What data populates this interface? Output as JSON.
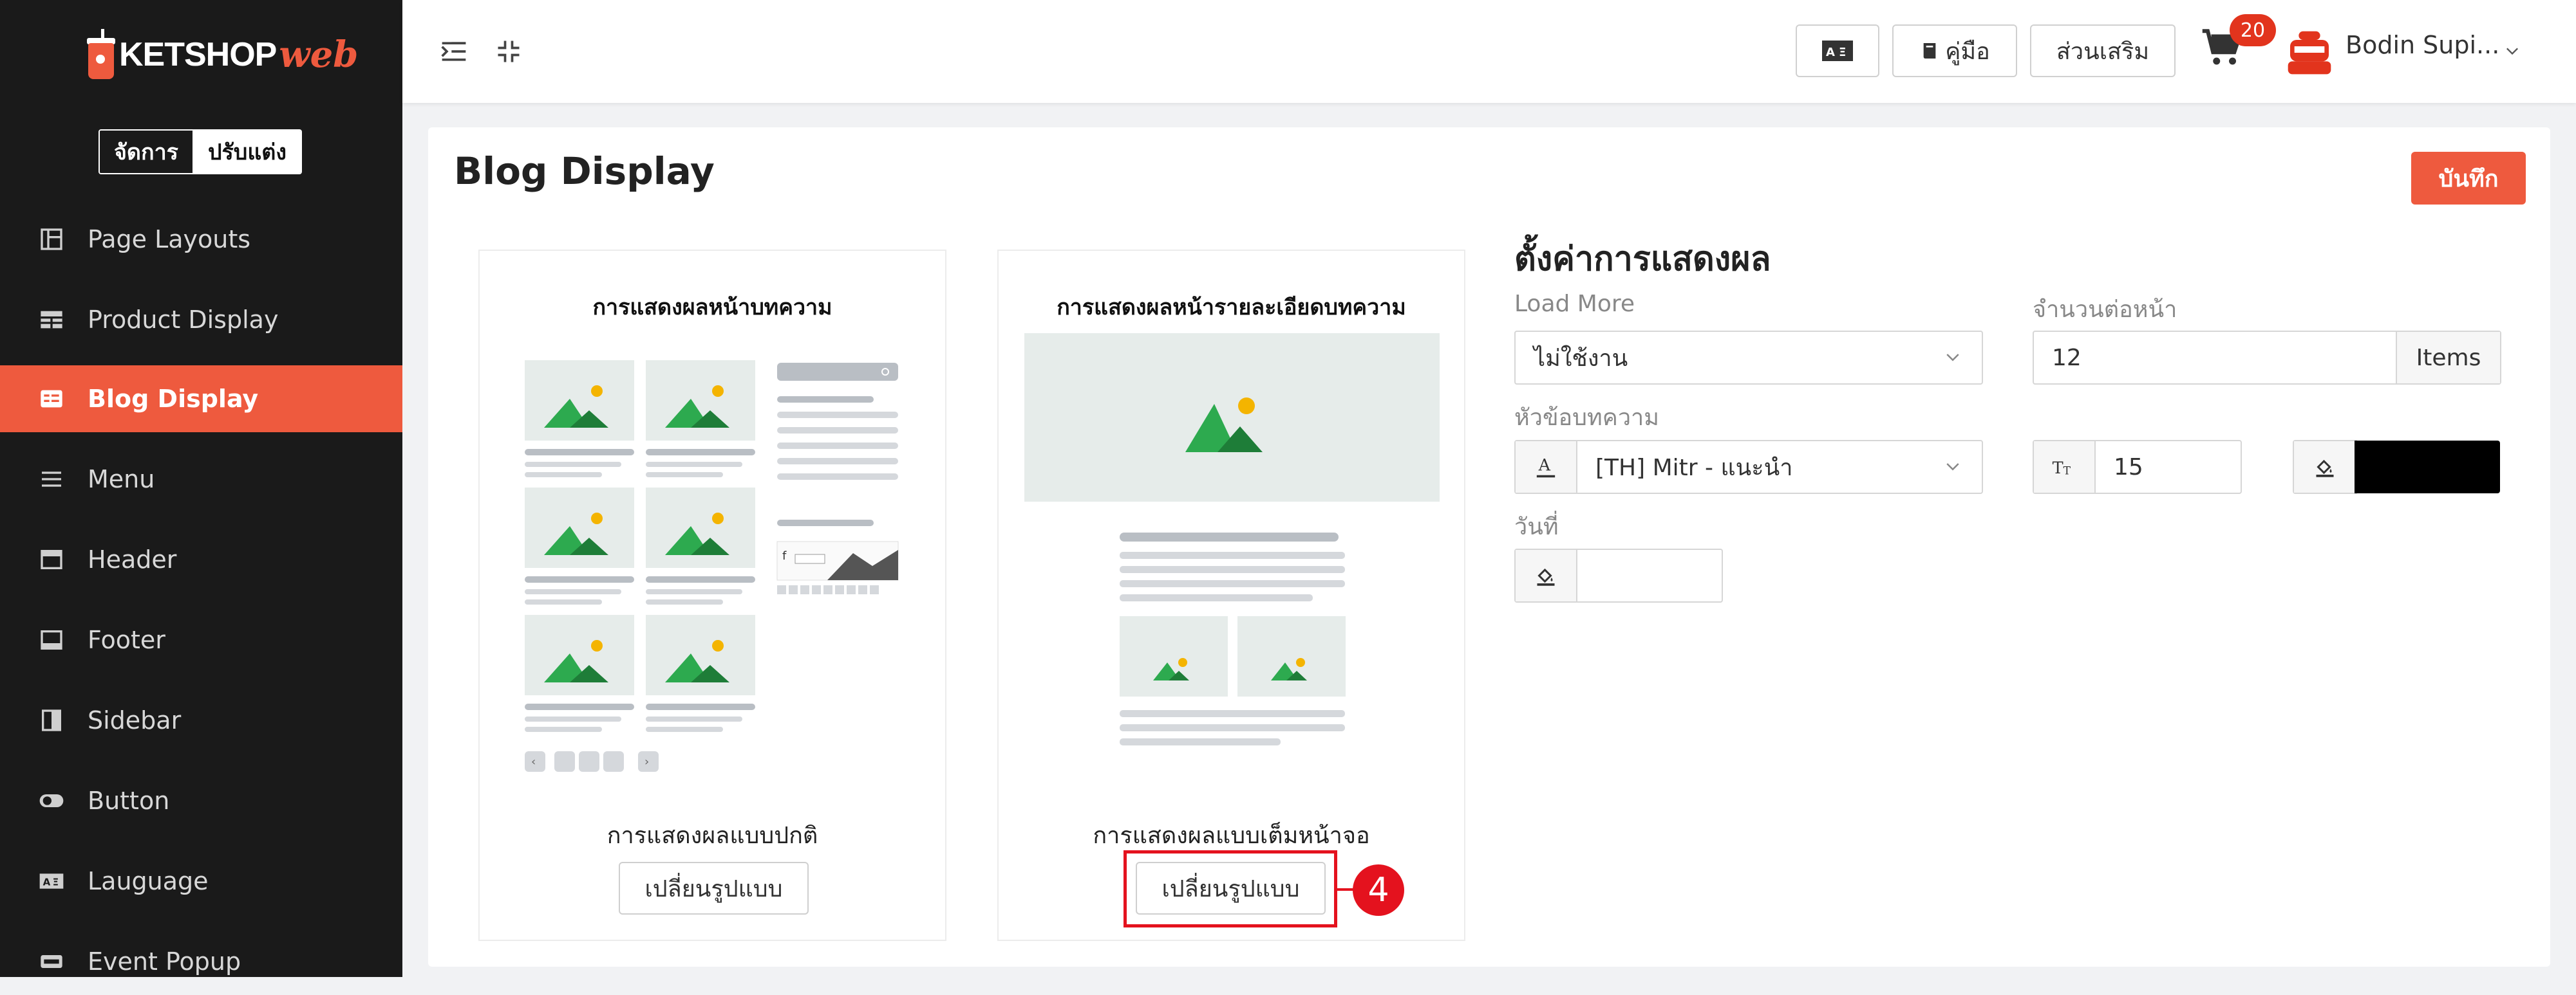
{
  "brand": {
    "name": "KETSHOP",
    "suffix": "web"
  },
  "mode_toggle": {
    "manage": "จัดการ",
    "customize": "ปรับแต่ง"
  },
  "sidebar": {
    "items": [
      {
        "label": "Page Layouts",
        "icon": "layout-icon"
      },
      {
        "label": "Product Display",
        "icon": "grid-icon"
      },
      {
        "label": "Blog Display",
        "icon": "blog-icon",
        "active": true
      },
      {
        "label": "Menu",
        "icon": "menu-icon"
      },
      {
        "label": "Header",
        "icon": "header-icon"
      },
      {
        "label": "Footer",
        "icon": "footer-icon"
      },
      {
        "label": "Sidebar",
        "icon": "sidebar-icon"
      },
      {
        "label": "Button",
        "icon": "toggle-icon"
      },
      {
        "label": "Lauguage",
        "icon": "language-icon"
      },
      {
        "label": "Event Popup",
        "icon": "popup-icon"
      }
    ]
  },
  "topbar": {
    "manual_label": "คู่มือ",
    "addons_label": "ส่วนเสริม",
    "cart_count": "20",
    "user_name": "Bodin Supi..."
  },
  "page": {
    "title": "Blog Display",
    "save_label": "บันทึก"
  },
  "layouts": {
    "list": {
      "title": "การแสดงผลหน้าบทความ",
      "caption": "การแสดงผลแบบปกติ",
      "button": "เปลี่ยนรูปแบบ",
      "pagination": [
        "1",
        "2",
        "3"
      ]
    },
    "detail": {
      "title": "การแสดงผลหน้ารายละเอียดบทความ",
      "caption": "การแสดงผลแบบเต็มหน้าจอ",
      "button": "เปลี่ยนรูปแบบ"
    }
  },
  "callout": {
    "number": "4",
    "color": "#e4121e"
  },
  "settings": {
    "title": "ตั้งค่าการแสดงผล",
    "load_more": {
      "label": "Load More",
      "value": "ไม่ใช้งาน"
    },
    "per_page": {
      "label": "จำนวนต่อหน้า",
      "value": "12",
      "unit": "Items"
    },
    "headline": {
      "label": "หัวข้อบทความ",
      "font": "[TH] Mitr - แนะนำ",
      "size": "15",
      "color": "#000000"
    },
    "date": {
      "label": "วันที่",
      "value": ""
    }
  },
  "colors": {
    "accent": "#ee5a3e",
    "sidebar_bg": "#1a1a1a"
  }
}
